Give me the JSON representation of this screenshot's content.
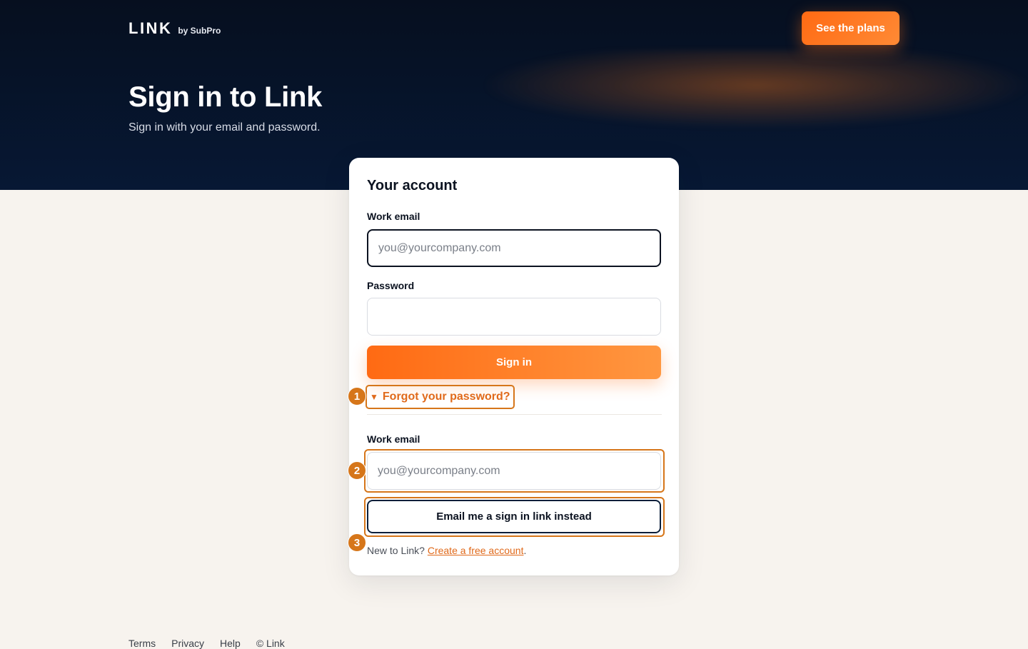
{
  "header": {
    "brand_name": "LINK",
    "brand_sub": "by SubPro",
    "plans_button": "See the plans"
  },
  "hero": {
    "title": "Sign in to Link",
    "subtitle": "Sign in with your email and password."
  },
  "card": {
    "title": "Your account",
    "email_label": "Work email",
    "email_placeholder": "you@yourcompany.com",
    "password_label": "Password",
    "password_value": "",
    "signin_button": "Sign in",
    "forgot_caret": "▼",
    "forgot_label": "Forgot your password?",
    "magic_email_label": "Work email",
    "magic_email_placeholder": "you@yourcompany.com",
    "magic_button": "Email me a sign in link instead",
    "new_text": "New to Link?",
    "create_link": "Create a free account",
    "period": "."
  },
  "badges": [
    "1",
    "2",
    "3"
  ],
  "footer": {
    "links": [
      "Terms",
      "Privacy",
      "Help",
      "© Link"
    ]
  },
  "colors": {
    "accent": "#ff6a13",
    "highlight": "#d6761a",
    "navy": "#060f1f",
    "background": "#f7f3ee"
  }
}
